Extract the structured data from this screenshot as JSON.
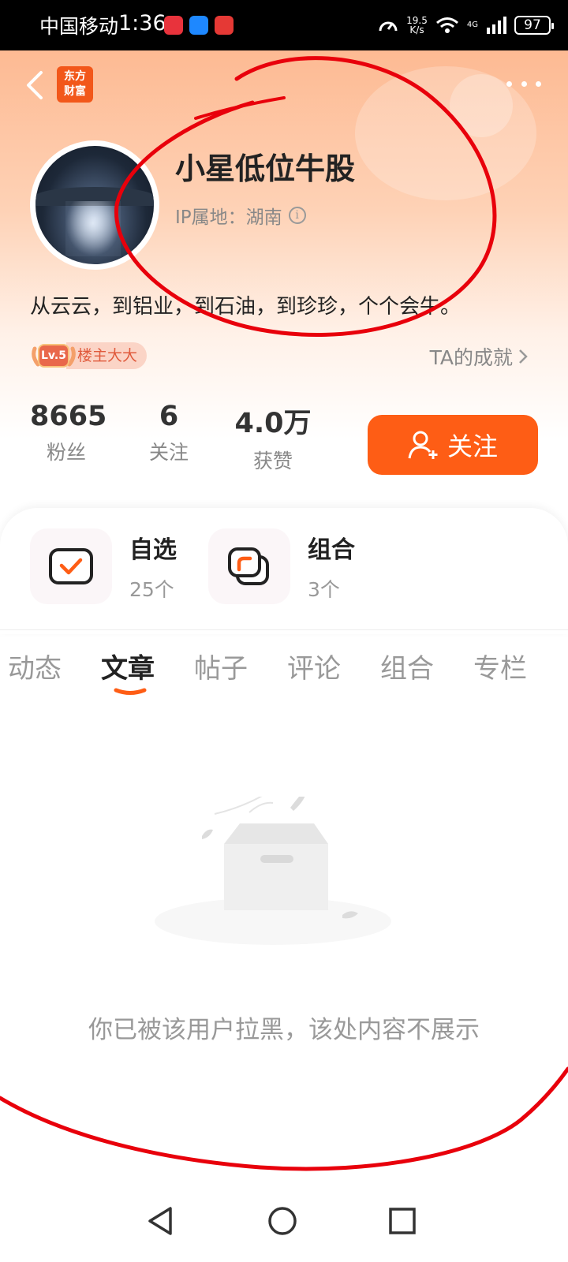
{
  "status_bar": {
    "carrier": "中国移动",
    "time": "1:36",
    "net_speed_value": "19.5",
    "net_speed_unit": "K/s",
    "network_type": "4G",
    "battery": "97"
  },
  "header": {
    "brand_logo_line1": "东方",
    "brand_logo_line2": "财富"
  },
  "profile": {
    "nickname": "小星低位牛股",
    "ip_location": "IP属地：湖南",
    "bio": "从云云，到铝业，到石油，到珍珍，个个会牛。",
    "level": "Lv.5",
    "level_title": "楼主大大",
    "achievements_link": "TA的成就"
  },
  "stats": [
    {
      "value": "8665",
      "label": "粉丝"
    },
    {
      "value": "6",
      "label": "关注"
    },
    {
      "value": "4.0万",
      "label": "获赞"
    }
  ],
  "follow_button": "关注",
  "portfolio_card": {
    "watchlist": {
      "title": "自选",
      "count": "25个"
    },
    "portfolio": {
      "title": "组合",
      "count": "3个"
    }
  },
  "tabs": [
    {
      "label": "动态",
      "active": false
    },
    {
      "label": "文章",
      "active": true
    },
    {
      "label": "帖子",
      "active": false
    },
    {
      "label": "评论",
      "active": false
    },
    {
      "label": "组合",
      "active": false
    },
    {
      "label": "专栏",
      "active": false
    }
  ],
  "empty_state": {
    "message": "你已被该用户拉黑，该处内容不展示"
  },
  "colors": {
    "accent": "#fe5d15",
    "annotation": "#e8000b"
  }
}
